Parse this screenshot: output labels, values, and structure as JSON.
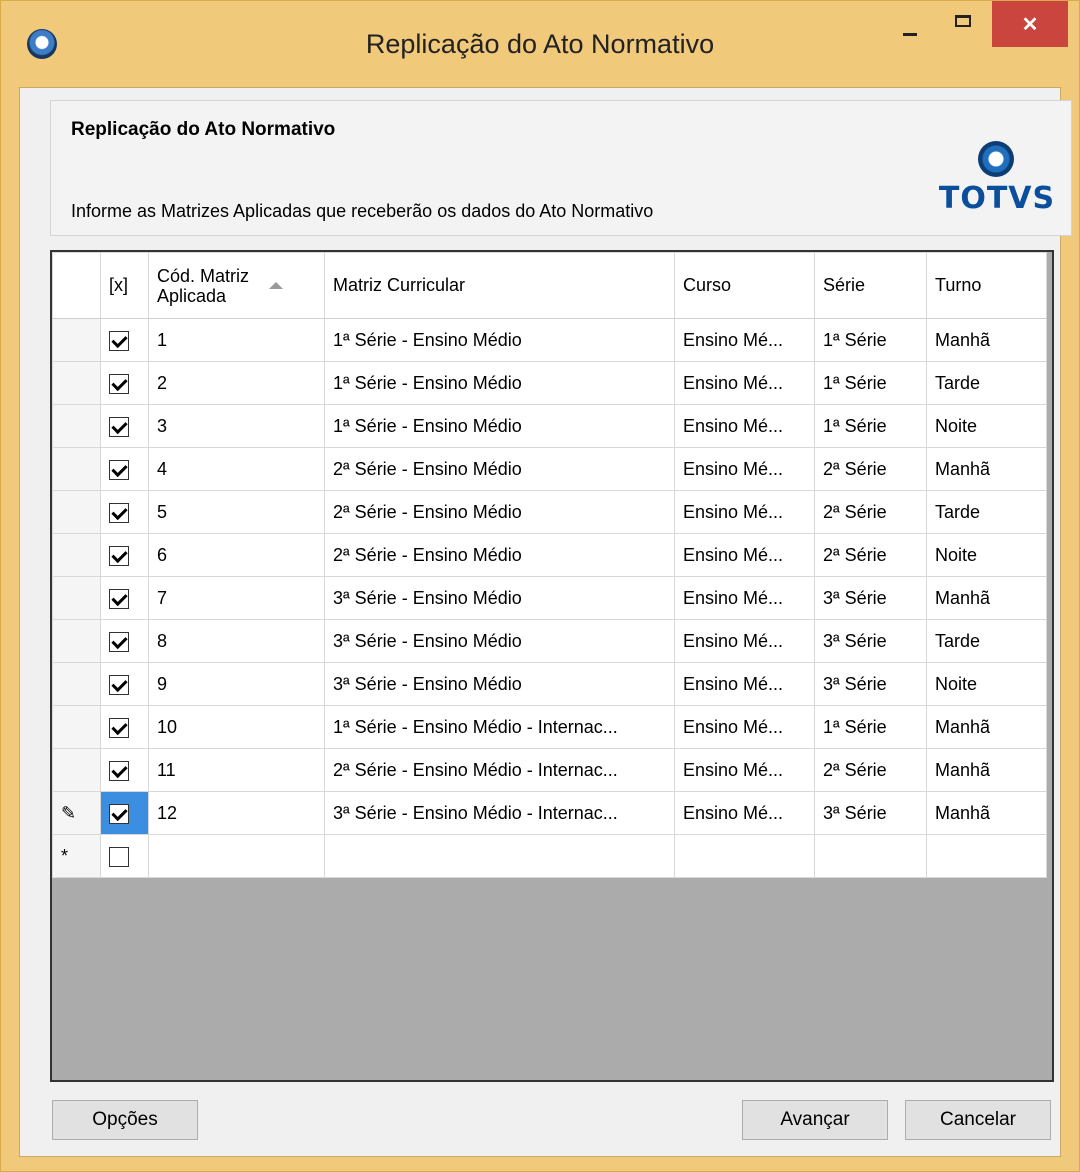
{
  "window": {
    "title": "Replicação do Ato Normativo",
    "close_glyph": "✕",
    "icon": "totvs-app-icon"
  },
  "header": {
    "title": "Replicação do Ato Normativo",
    "description": "Informe as Matrizes Aplicadas que receberão os dados do Ato Normativo",
    "logo_text": "TOTVS"
  },
  "grid": {
    "columns": {
      "check": "[x]",
      "cod_line1": "Cód. Matriz",
      "cod_line2": "Aplicada",
      "matriz": "Matriz Curricular",
      "curso": "Curso",
      "serie": "Série",
      "turno": "Turno"
    },
    "rows": [
      {
        "checked": true,
        "cod": "1",
        "matriz": "1ª Série - Ensino Médio",
        "curso": "Ensino Mé...",
        "serie": "1ª Série",
        "turno": "Manhã"
      },
      {
        "checked": true,
        "cod": "2",
        "matriz": "1ª Série - Ensino Médio",
        "curso": "Ensino Mé...",
        "serie": "1ª Série",
        "turno": "Tarde"
      },
      {
        "checked": true,
        "cod": "3",
        "matriz": "1ª Série - Ensino Médio",
        "curso": "Ensino Mé...",
        "serie": "1ª Série",
        "turno": "Noite"
      },
      {
        "checked": true,
        "cod": "4",
        "matriz": "2ª Série - Ensino Médio",
        "curso": "Ensino Mé...",
        "serie": "2ª Série",
        "turno": "Manhã"
      },
      {
        "checked": true,
        "cod": "5",
        "matriz": "2ª Série - Ensino Médio",
        "curso": "Ensino Mé...",
        "serie": "2ª Série",
        "turno": "Tarde"
      },
      {
        "checked": true,
        "cod": "6",
        "matriz": "2ª Série - Ensino Médio",
        "curso": "Ensino Mé...",
        "serie": "2ª Série",
        "turno": "Noite"
      },
      {
        "checked": true,
        "cod": "7",
        "matriz": "3ª Série - Ensino Médio",
        "curso": "Ensino Mé...",
        "serie": "3ª Série",
        "turno": "Manhã"
      },
      {
        "checked": true,
        "cod": "8",
        "matriz": "3ª Série - Ensino Médio",
        "curso": "Ensino Mé...",
        "serie": "3ª Série",
        "turno": "Tarde"
      },
      {
        "checked": true,
        "cod": "9",
        "matriz": "3ª Série - Ensino Médio",
        "curso": "Ensino Mé...",
        "serie": "3ª Série",
        "turno": "Noite"
      },
      {
        "checked": true,
        "cod": "10",
        "matriz": "1ª Série - Ensino Médio - Internac...",
        "curso": "Ensino Mé...",
        "serie": "1ª Série",
        "turno": "Manhã"
      },
      {
        "checked": true,
        "cod": "11",
        "matriz": "2ª Série - Ensino Médio - Internac...",
        "curso": "Ensino Mé...",
        "serie": "2ª Série",
        "turno": "Manhã"
      },
      {
        "checked": true,
        "cod": "12",
        "matriz": "3ª Série - Ensino Médio - Internac...",
        "curso": "Ensino Mé...",
        "serie": "3ª Série",
        "turno": "Manhã"
      }
    ],
    "edit_row_marker": "✎",
    "new_row_marker": "*"
  },
  "buttons": {
    "options": "Opções",
    "next": "Avançar",
    "cancel": "Cancelar"
  }
}
